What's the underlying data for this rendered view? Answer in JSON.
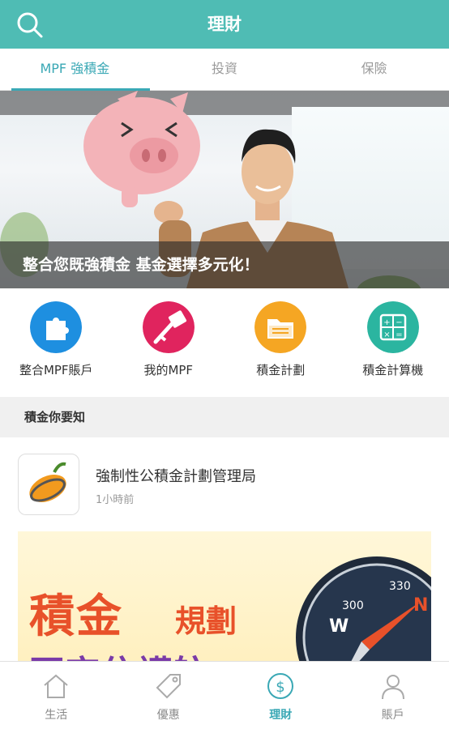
{
  "header": {
    "title": "理財"
  },
  "tabs": [
    {
      "label": "MPF 強積金",
      "active": true
    },
    {
      "label": "投資",
      "active": false
    },
    {
      "label": "保險",
      "active": false
    }
  ],
  "banner": {
    "caption": "整合您既強積金 基金選擇多元化！"
  },
  "quick_actions": [
    {
      "label": "整合MPF賬戶",
      "icon": "puzzle-icon",
      "color": "#1e8fe0"
    },
    {
      "label": "我的MPF",
      "icon": "key-icon",
      "color": "#e0245e"
    },
    {
      "label": "積金計劃",
      "icon": "folder-icon",
      "color": "#f5a623"
    },
    {
      "label": "積金計算機",
      "icon": "calculator-icon",
      "color": "#2bb5a0"
    }
  ],
  "section": {
    "title": "積金你要知"
  },
  "post": {
    "author": "強制性公積金計劃管理局",
    "time": "1小時前",
    "media_text": [
      "積金",
      "規劃",
      "至定住護航"
    ]
  },
  "bottom_nav": [
    {
      "label": "生活",
      "icon": "home-icon",
      "active": false
    },
    {
      "label": "優惠",
      "icon": "tag-icon",
      "active": false
    },
    {
      "label": "理財",
      "icon": "dollar-icon",
      "active": true
    },
    {
      "label": "賬戶",
      "icon": "user-icon",
      "active": false
    }
  ],
  "colors": {
    "accent": "#4fbcb4",
    "tab_active": "#3aa8b5"
  }
}
